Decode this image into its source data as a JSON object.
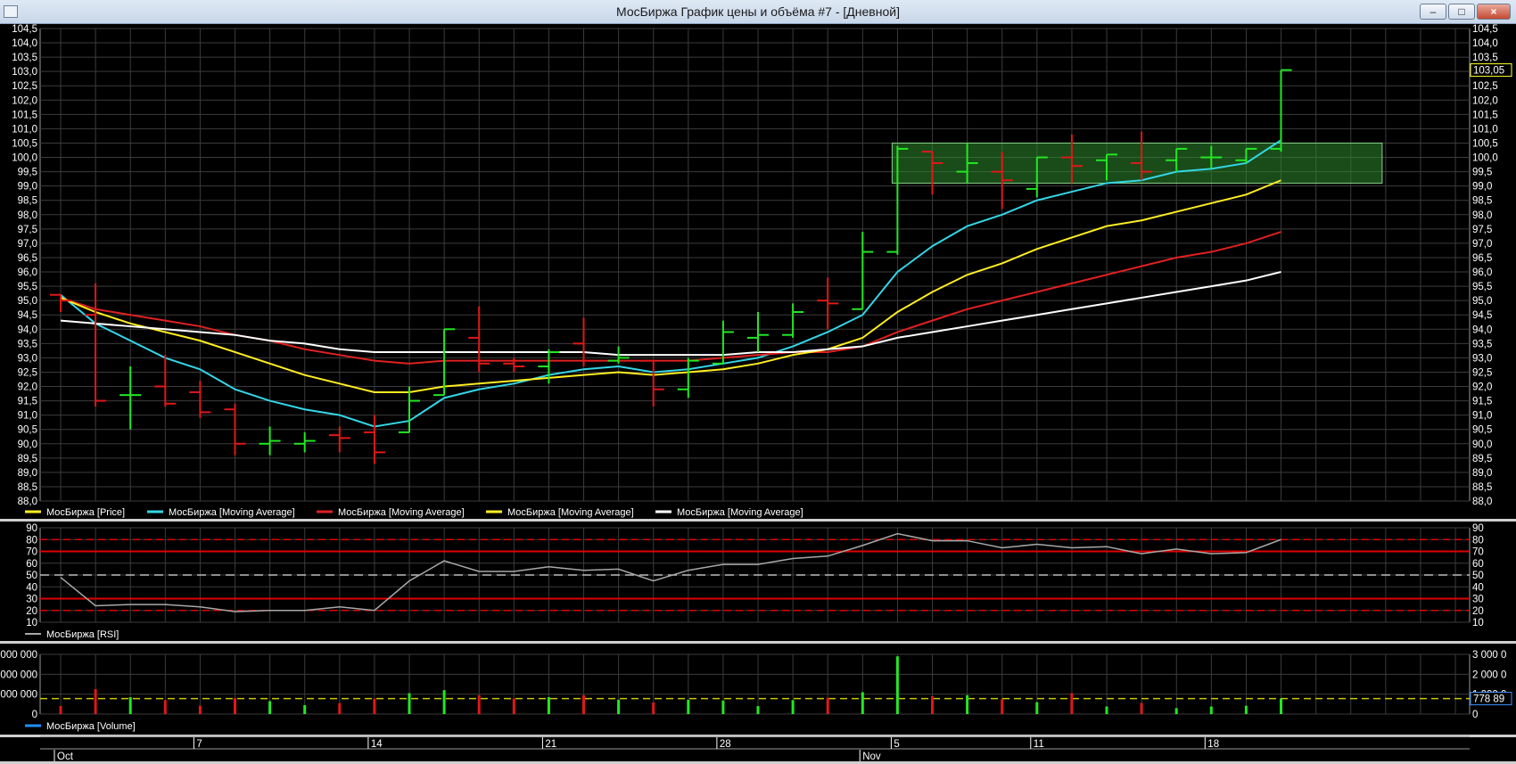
{
  "window": {
    "title": "МосБиржа График цены и объёма #7 - [Дневной]",
    "min_label": "‒",
    "max_label": "□",
    "close_label": "×"
  },
  "colors": {
    "up": "#22e822",
    "down": "#e01818",
    "grid": "#3c3c3c",
    "ma_fast": "#33d6e6",
    "ma_red": "#e02020",
    "ma_yellow": "#ffee22",
    "ma_white": "#ffffff",
    "rsi": "#a8a8a8",
    "level_red": "#e00000",
    "level_white": "#bdbdbd",
    "avg_volume": "#c8c800",
    "highlight_fill": "#2d8a2d",
    "highlight_stroke": "#8ad08a"
  },
  "chart_data": [
    {
      "type": "ohlc",
      "panel": "price",
      "y_ticks": [
        "88,0",
        "88,5",
        "89,0",
        "89,5",
        "90,0",
        "90,5",
        "91,0",
        "91,5",
        "92,0",
        "92,5",
        "93,0",
        "93,5",
        "94,0",
        "94,5",
        "95,0",
        "95,5",
        "96,0",
        "96,5",
        "97,0",
        "97,5",
        "98,0",
        "98,5",
        "99,0",
        "99,5",
        "100,0",
        "100,5",
        "101,0",
        "101,5",
        "102,0",
        "102,5",
        "103,0",
        "103,5",
        "104,0",
        "104,5"
      ],
      "ylim": [
        88.0,
        104.5
      ],
      "last_value_label": "103,05",
      "last_value": 103.05,
      "x_tick_labels": [
        "Oct",
        "7",
        "14",
        "21",
        "28",
        "Nov",
        "5",
        "11",
        "18"
      ],
      "bars": [
        {
          "o": 95.2,
          "h": 95.2,
          "l": 94.6,
          "c": 95.0
        },
        {
          "o": 94.5,
          "h": 95.6,
          "l": 91.3,
          "c": 91.5
        },
        {
          "o": 91.7,
          "h": 92.7,
          "l": 90.5,
          "c": 91.7
        },
        {
          "o": 92.0,
          "h": 93.1,
          "l": 91.3,
          "c": 91.4
        },
        {
          "o": 91.8,
          "h": 92.2,
          "l": 90.9,
          "c": 91.1
        },
        {
          "o": 91.2,
          "h": 91.4,
          "l": 89.6,
          "c": 90.0
        },
        {
          "o": 90.0,
          "h": 90.6,
          "l": 89.6,
          "c": 90.1
        },
        {
          "o": 90.0,
          "h": 90.4,
          "l": 89.7,
          "c": 90.1
        },
        {
          "o": 90.3,
          "h": 90.6,
          "l": 89.7,
          "c": 90.2
        },
        {
          "o": 90.4,
          "h": 91.0,
          "l": 89.3,
          "c": 89.7
        },
        {
          "o": 90.4,
          "h": 92.0,
          "l": 90.4,
          "c": 91.5
        },
        {
          "o": 91.7,
          "h": 94.0,
          "l": 91.7,
          "c": 94.0
        },
        {
          "o": 93.7,
          "h": 94.8,
          "l": 92.5,
          "c": 92.8
        },
        {
          "o": 92.8,
          "h": 93.0,
          "l": 92.5,
          "c": 92.7
        },
        {
          "o": 92.7,
          "h": 93.3,
          "l": 92.1,
          "c": 93.2
        },
        {
          "o": 93.5,
          "h": 94.4,
          "l": 92.7,
          "c": 92.9
        },
        {
          "o": 92.9,
          "h": 93.4,
          "l": 92.8,
          "c": 93.0
        },
        {
          "o": 92.9,
          "h": 92.9,
          "l": 91.3,
          "c": 91.9
        },
        {
          "o": 91.9,
          "h": 93.0,
          "l": 91.6,
          "c": 92.9
        },
        {
          "o": 92.8,
          "h": 94.3,
          "l": 92.8,
          "c": 93.9
        },
        {
          "o": 93.7,
          "h": 94.6,
          "l": 93.2,
          "c": 93.8
        },
        {
          "o": 93.8,
          "h": 94.9,
          "l": 93.7,
          "c": 94.6
        },
        {
          "o": 95.0,
          "h": 95.8,
          "l": 94.0,
          "c": 94.9
        },
        {
          "o": 94.7,
          "h": 97.4,
          "l": 94.7,
          "c": 96.7
        },
        {
          "o": 96.7,
          "h": 100.4,
          "l": 96.6,
          "c": 100.3
        },
        {
          "o": 100.2,
          "h": 100.2,
          "l": 98.7,
          "c": 99.8
        },
        {
          "o": 99.5,
          "h": 100.5,
          "l": 99.1,
          "c": 99.8
        },
        {
          "o": 99.5,
          "h": 100.2,
          "l": 98.2,
          "c": 99.2
        },
        {
          "o": 98.9,
          "h": 100.0,
          "l": 98.6,
          "c": 100.0
        },
        {
          "o": 100.0,
          "h": 100.8,
          "l": 99.1,
          "c": 99.7
        },
        {
          "o": 99.9,
          "h": 100.1,
          "l": 99.2,
          "c": 100.1
        },
        {
          "o": 99.8,
          "h": 100.9,
          "l": 99.2,
          "c": 99.5
        },
        {
          "o": 99.9,
          "h": 100.3,
          "l": 99.5,
          "c": 100.3
        },
        {
          "o": 100.0,
          "h": 100.4,
          "l": 99.6,
          "c": 100.0
        },
        {
          "o": 99.9,
          "h": 100.3,
          "l": 99.8,
          "c": 100.3
        },
        {
          "o": 100.3,
          "h": 103.05,
          "l": 100.2,
          "c": 103.05
        }
      ],
      "series": [
        {
          "name": "МосБиржа [Moving Average]",
          "color_key": "ma_fast",
          "values": [
            95.2,
            94.2,
            93.6,
            93.0,
            92.6,
            91.9,
            91.5,
            91.2,
            91.0,
            90.6,
            90.8,
            91.6,
            91.9,
            92.1,
            92.4,
            92.6,
            92.7,
            92.5,
            92.6,
            92.8,
            93.0,
            93.4,
            93.9,
            94.5,
            96.0,
            96.9,
            97.6,
            98.0,
            98.5,
            98.8,
            99.1,
            99.2,
            99.5,
            99.6,
            99.8,
            100.6
          ]
        },
        {
          "name": "МосБиржа [Moving Average]",
          "color_key": "ma_red",
          "values": [
            95.1,
            94.7,
            94.5,
            94.3,
            94.1,
            93.8,
            93.6,
            93.3,
            93.1,
            92.9,
            92.8,
            92.9,
            92.9,
            92.9,
            92.9,
            92.9,
            92.9,
            92.9,
            92.9,
            93.0,
            93.1,
            93.2,
            93.2,
            93.4,
            93.9,
            94.3,
            94.7,
            95.0,
            95.3,
            95.6,
            95.9,
            96.2,
            96.5,
            96.7,
            97.0,
            97.4
          ]
        },
        {
          "name": "МосБиржа [Moving Average]",
          "color_key": "ma_yellow",
          "values": [
            95.1,
            94.6,
            94.2,
            93.9,
            93.6,
            93.2,
            92.8,
            92.4,
            92.1,
            91.8,
            91.8,
            92.0,
            92.1,
            92.2,
            92.3,
            92.4,
            92.5,
            92.4,
            92.5,
            92.6,
            92.8,
            93.1,
            93.3,
            93.7,
            94.6,
            95.3,
            95.9,
            96.3,
            96.8,
            97.2,
            97.6,
            97.8,
            98.1,
            98.4,
            98.7,
            99.2
          ]
        },
        {
          "name": "МосБиржа [Moving Average]",
          "color_key": "ma_white",
          "values": [
            94.3,
            94.2,
            94.1,
            94.0,
            93.9,
            93.8,
            93.6,
            93.5,
            93.3,
            93.2,
            93.2,
            93.2,
            93.2,
            93.2,
            93.2,
            93.2,
            93.1,
            93.1,
            93.1,
            93.1,
            93.2,
            93.2,
            93.3,
            93.4,
            93.7,
            93.9,
            94.1,
            94.3,
            94.5,
            94.7,
            94.9,
            95.1,
            95.3,
            95.5,
            95.7,
            96.0
          ]
        }
      ],
      "highlight": {
        "x_from_index": 24,
        "x_to_index": 37.9,
        "y_from": 99.1,
        "y_to": 100.5
      },
      "legend": [
        {
          "label": "МосБиржа [Price]",
          "color_key": "ma_yellow"
        },
        {
          "label": "МосБиржа [Moving Average]",
          "color_key": "ma_fast"
        },
        {
          "label": "МосБиржа [Moving Average]",
          "color_key": "ma_red"
        },
        {
          "label": "МосБиржа [Moving Average]",
          "color_key": "ma_yellow"
        },
        {
          "label": "МосБиржа [Moving Average]",
          "color_key": "ma_white"
        }
      ]
    },
    {
      "type": "line",
      "panel": "rsi",
      "name": "МосБиржа [RSI]",
      "y_ticks": [
        "10",
        "20",
        "30",
        "40",
        "50",
        "60",
        "70",
        "80",
        "90"
      ],
      "ylim": [
        10,
        90
      ],
      "levels_red": [
        20,
        30,
        70,
        80
      ],
      "level_white": 50,
      "values": [
        48,
        24,
        25,
        25,
        23,
        19,
        20,
        20,
        23,
        20,
        45,
        62,
        53,
        53,
        57,
        54,
        55,
        45,
        54,
        59,
        59,
        64,
        66,
        75,
        85,
        79,
        79,
        73,
        76,
        73,
        74,
        68,
        72,
        68,
        69,
        80
      ]
    },
    {
      "type": "bar",
      "panel": "volume",
      "name": "МосБиржа [Volume]",
      "y_ticks_left": [
        "0",
        "000 000",
        "000 000",
        "000 000"
      ],
      "y_ticks_right": [
        "0",
        "1 000 0",
        "2 000 0",
        "3 000 0"
      ],
      "ylim": [
        0,
        3000000
      ],
      "average_label": "778 89",
      "average_value": 778890,
      "values": [
        400000,
        1250000,
        850000,
        700000,
        420000,
        800000,
        650000,
        450000,
        550000,
        780000,
        1050000,
        1200000,
        950000,
        780000,
        850000,
        950000,
        720000,
        580000,
        720000,
        680000,
        400000,
        700000,
        820000,
        1100000,
        2900000,
        900000,
        950000,
        750000,
        600000,
        1050000,
        380000,
        560000,
        300000,
        380000,
        420000,
        780000
      ]
    }
  ]
}
